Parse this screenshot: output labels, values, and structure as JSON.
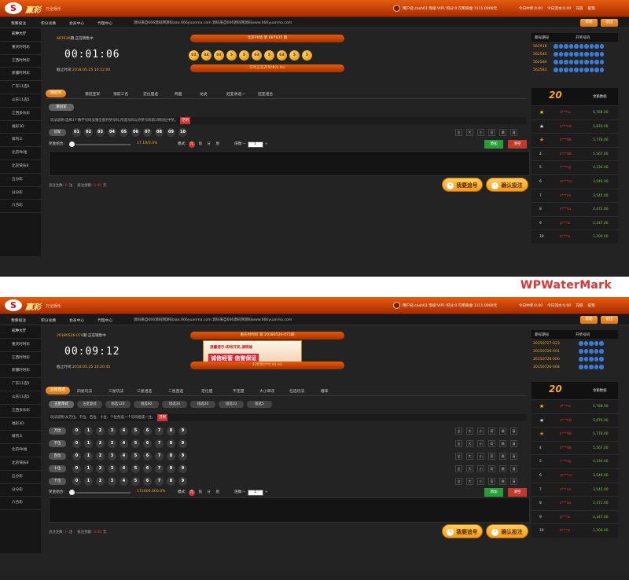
{
  "watermark": "WPWaterMark",
  "brand": {
    "logo": "S",
    "name": "赢彩",
    "subtitle": "万全娱乐"
  },
  "top": {
    "userinfo": "用户名:cash01  等级:VIP1  积分:0  可用资金:1111.0000元",
    "links": [
      "今日中奖:0.00",
      "今日流水:0.00",
      "充值",
      "提现"
    ]
  },
  "nav": {
    "items": [
      "我要投注",
      "积分兑换",
      "会员中心",
      "代理中心"
    ],
    "notice": "源码来自666源码网源码aaa.666yuanma.com 源码来自666源码网源码www.666yuanma.com",
    "buttons": [
      "帮助",
      "退出"
    ]
  },
  "sidebar": [
    "彩种大厅",
    "重庆时时彩",
    "江西时时彩",
    "新疆时时彩",
    "广东11选5",
    "山东11选5",
    "江西多乐彩",
    "福彩3D",
    "排列三",
    "北京PK拾",
    "北京快乐8",
    "五分彩",
    "分分彩",
    "六合彩"
  ],
  "panels": [
    {
      "period": "687636",
      "period_status": "期 正在销售中",
      "countdown": "00:01:06",
      "deadline_label": "截止时间:",
      "deadline": "2018.05.25 10:12:00",
      "draw_header": "北京PK拾 第 687635 期",
      "draw_balls": [
        "01",
        "04",
        "01",
        "5",
        "5",
        "03",
        "5",
        "03",
        "5",
        "5"
      ],
      "draw_bar": "实时正在开奖中(0.0s)",
      "history_header": [
        "期号期号",
        "开奖号码"
      ],
      "history": [
        {
          "issue": "562918",
          "nums": [
            "01",
            "02",
            "03",
            "04",
            "05",
            "06",
            "07",
            "08",
            "09",
            "10"
          ]
        },
        {
          "issue": "562585",
          "nums": [
            "01",
            "02",
            "03",
            "04",
            "05",
            "06",
            "07",
            "08",
            "09",
            "10"
          ]
        },
        {
          "issue": "562584",
          "nums": [
            "01",
            "02",
            "03",
            "04",
            "05",
            "06",
            "07",
            "08",
            "09",
            "10"
          ]
        },
        {
          "issue": "562583",
          "nums": [
            "01",
            "02",
            "03",
            "04",
            "05",
            "06",
            "07",
            "08",
            "09",
            "10"
          ]
        }
      ],
      "tabs": [
        "猜冠军",
        "猜冠亚军",
        "猜前三名",
        "定位胆选",
        "两面",
        "龙虎",
        "冠亚季选一",
        "冠亚组合"
      ],
      "subtabs": [
        "猜冠军"
      ],
      "hint": "玩法说明:选择1个数字号码竞猜全部开奖号码,所选号码与开奖号码前1项同位中奖。",
      "hint_tag": "范例",
      "rows": [
        {
          "label": "冠军",
          "numbers": [
            "01",
            "02",
            "03",
            "04",
            "05",
            "06",
            "07",
            "08",
            "09",
            "10"
          ]
        }
      ],
      "quick": [
        "全",
        "大",
        "小",
        "奇",
        "偶",
        "清"
      ],
      "bet_label": "奖金组合:",
      "bet_value": "17.19/0.0%",
      "mode_label": "模式:",
      "modes": [
        "元",
        "角",
        "分",
        "厘"
      ],
      "mult_label": "倍数:",
      "mult_value": "1",
      "add_btn": "添加",
      "clear_btn": "清空",
      "total_count_label": "总注注数:",
      "total_count": "0",
      "total_count_unit": "注",
      "total_amount_label": "投注金额:",
      "total_amount": "0.00",
      "total_amount_unit": "元",
      "chase_btn": "我要追号",
      "confirm_btn": "确认投注"
    },
    {
      "period": "20180526-074",
      "period_status": "期 正在销售中",
      "countdown": "00:09:12",
      "deadline_label": "截止时间:",
      "deadline": "2018.05.25 10:20:45",
      "draw_header": "重庆时时彩 第 20180526-073期",
      "ad_title": "温馨提示:即将开奖,请稍候",
      "ad_big": "诚信经营  信誉保证",
      "draw_bar": "开奖倒计时:00:42",
      "history_header": [
        "期号期号",
        "开奖号码"
      ],
      "history": [
        {
          "issue": "20150727-023",
          "nums": [
            "?",
            "?",
            "?",
            "?",
            "?"
          ]
        },
        {
          "issue": "20150726-001",
          "nums": [
            "?",
            "?",
            "?",
            "?",
            "?"
          ]
        },
        {
          "issue": "20150726-000",
          "nums": [
            "?",
            "?",
            "?",
            "?",
            "?"
          ]
        },
        {
          "issue": "20150726-008",
          "nums": [
            "?",
            "?",
            "?",
            "?",
            "?"
          ]
        }
      ],
      "tabs": [
        "五星直选",
        "四星玩法",
        "三星玩法",
        "三星组选",
        "二星直选",
        "定位胆",
        "不定胆",
        "大小单双",
        "任选玩法",
        "趣味"
      ],
      "subtabs": [
        "五星单式",
        "五星复式",
        "组选120",
        "组选60",
        "组选30",
        "组选20",
        "组选10",
        "组选5"
      ],
      "hint": "玩法说明:从万位、千位、百位、十位、个位各选一个号码组成一注。",
      "hint_tag": "范例",
      "rows": [
        {
          "label": "万位",
          "numbers": [
            "0",
            "1",
            "2",
            "3",
            "4",
            "5",
            "6",
            "7",
            "8",
            "9"
          ]
        },
        {
          "label": "千位",
          "numbers": [
            "0",
            "1",
            "2",
            "3",
            "4",
            "5",
            "6",
            "7",
            "8",
            "9"
          ]
        },
        {
          "label": "百位",
          "numbers": [
            "0",
            "1",
            "2",
            "3",
            "4",
            "5",
            "6",
            "7",
            "8",
            "9"
          ]
        },
        {
          "label": "十位",
          "numbers": [
            "0",
            "1",
            "2",
            "3",
            "4",
            "5",
            "6",
            "7",
            "8",
            "9"
          ]
        },
        {
          "label": "个位",
          "numbers": [
            "0",
            "1",
            "2",
            "3",
            "4",
            "5",
            "6",
            "7",
            "8",
            "9"
          ]
        }
      ],
      "quick": [
        "全",
        "大",
        "小",
        "奇",
        "偶",
        "清"
      ],
      "bet_label": "奖金组合:",
      "bet_value": "172000.000.0%",
      "mode_label": "模式:",
      "modes": [
        "元",
        "角",
        "分",
        "厘"
      ],
      "mult_label": "倍数:",
      "mult_value": "1",
      "add_btn": "添加",
      "clear_btn": "清空",
      "total_count_label": "总注注数:",
      "total_count": "0",
      "total_count_unit": "注",
      "total_amount_label": "投注金额:",
      "total_amount": "0.00",
      "total_amount_unit": "元",
      "chase_btn": "我要追号",
      "confirm_btn": "确认投注"
    }
  ],
  "rank": {
    "title": "20",
    "col": "金额数据",
    "rows": [
      {
        "no": "1",
        "user": "d***ss",
        "amount": "6,788.00"
      },
      {
        "no": "2",
        "user": "a***n8",
        "amount": "5,876.00"
      },
      {
        "no": "3",
        "user": "k***88",
        "amount": "5,778.00"
      },
      {
        "no": "4",
        "user": "k***88",
        "amount": "5,567.00"
      },
      {
        "no": "5",
        "user": "r***ng",
        "amount": "4,334.00"
      },
      {
        "no": "6",
        "user": "m***ss",
        "amount": "3,546.00"
      },
      {
        "no": "7",
        "user": "s***an",
        "amount": "3,545.00"
      },
      {
        "no": "8",
        "user": "s***ao",
        "amount": "2,472.00"
      },
      {
        "no": "9",
        "user": "p***ai",
        "amount": "2,247.00"
      },
      {
        "no": "10",
        "user": "b***ai",
        "amount": "1,200.00"
      }
    ]
  },
  "colors": {
    "accent": "#f39a1a",
    "topbar": "#c53e05",
    "bg": "#232323",
    "red": "#e33333",
    "green": "#7fc243"
  }
}
